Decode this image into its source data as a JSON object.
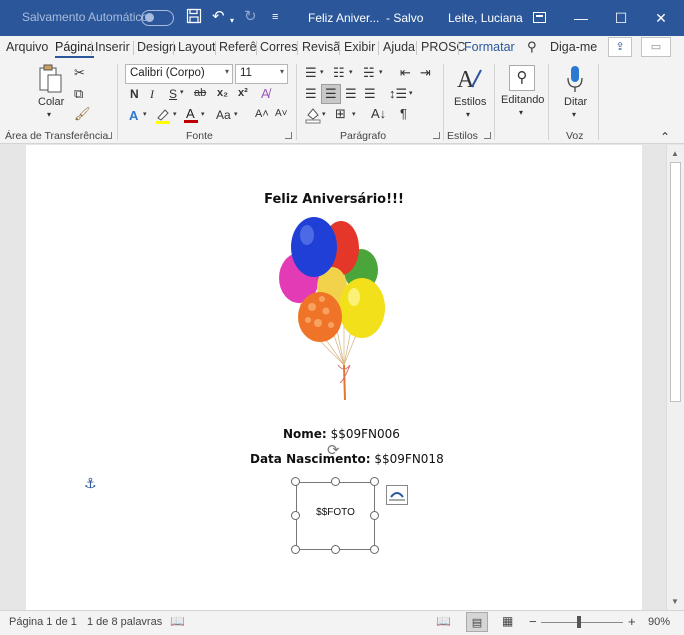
{
  "titlebar": {
    "autosave_label": "Salvamento Automático",
    "doc_title": "Feliz Aniver...",
    "save_state": "- Salvo",
    "user": "Leite, Luciana",
    "accent": "#2b579a"
  },
  "menu": {
    "tabs": [
      "Arquivo",
      "Página",
      "Inserir",
      "Design",
      "Layout",
      "Referê",
      "Corres",
      "Revisã",
      "Exibir",
      "Ajuda",
      "PROSC",
      "Formatar"
    ],
    "active_tab": "Página",
    "search_label": "Diga-me"
  },
  "ribbon": {
    "clipboard": {
      "paste_label": "Colar",
      "group_label": "Área de Transferência"
    },
    "font": {
      "family": "Calibri (Corpo)",
      "size": "11",
      "group_label": "Fonte",
      "bold": "N",
      "italic": "I",
      "underline": "S",
      "strike": "ab",
      "subscript": "x₂",
      "superscript": "x²",
      "font_color_letter": "A",
      "text_effects": "A",
      "change_case": "Aa",
      "grow": "A˄",
      "shrink": "A˅"
    },
    "paragraph": {
      "group_label": "Parágrafo"
    },
    "styles": {
      "label": "Estilos",
      "group_label": "Estilos"
    },
    "editing": {
      "label": "Editando"
    },
    "voice": {
      "label": "Ditar",
      "group_label": "Voz"
    }
  },
  "document": {
    "heading": "Feliz Aniversário!!!",
    "name_label": "Nome:",
    "name_value": "$$09FN006",
    "birth_label": "Data Nascimento:",
    "birth_value": "$$09FN018",
    "photo_placeholder": "$$FOTO"
  },
  "statusbar": {
    "page": "Página 1 de 1",
    "words": "1 de 8 palavras",
    "zoom": "90%",
    "zoom_minus": "−",
    "zoom_plus": "+"
  }
}
